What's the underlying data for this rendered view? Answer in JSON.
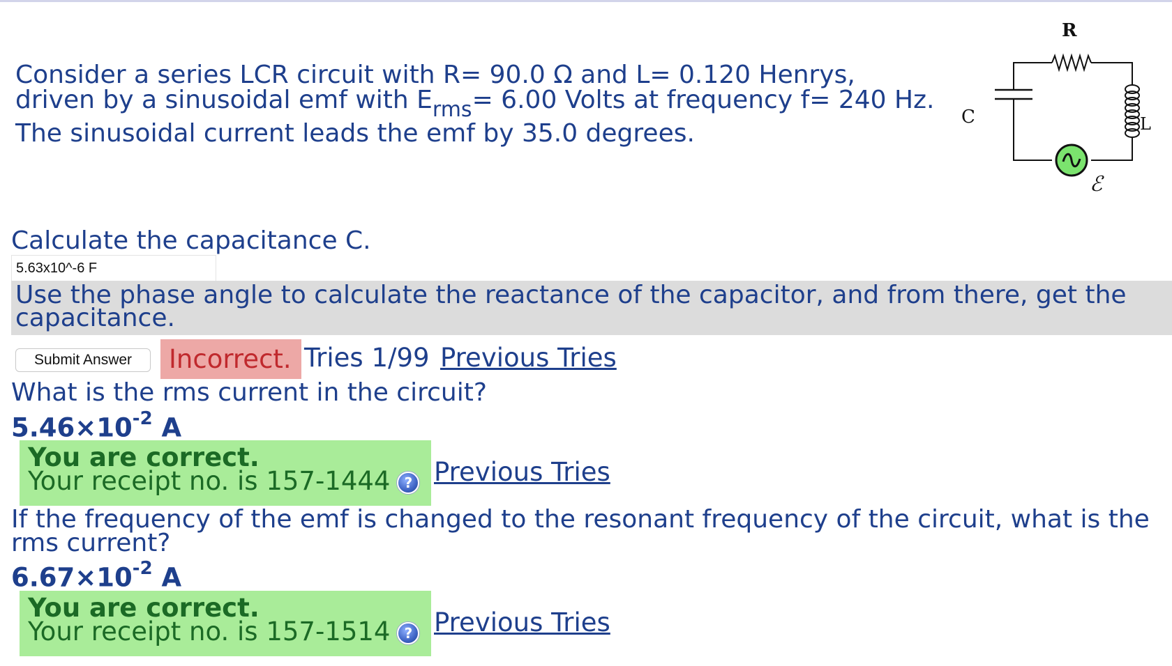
{
  "problem": {
    "line1": "Consider a series LCR circuit with R= 90.0 Ω and L= 0.120 Henrys,",
    "line2_pre": "driven by a sinusoidal emf with E",
    "line2_sub": "rms",
    "line2_post": "= 6.00 Volts at frequency f= 240 Hz.",
    "line3": "The sinusoidal current leads the emf by 35.0 degrees."
  },
  "circuit": {
    "label_R": "R",
    "label_C": "C",
    "label_L": "L",
    "label_emf": "ℰ",
    "source_color": "#7be36e"
  },
  "q1": {
    "question": "Calculate the capacitance C.",
    "input_value": "5.63x10^-6 F",
    "hint": "Use the phase angle to calculate the reactance of the capacitor, and from there, get the capacitance.",
    "submit_label": "Submit Answer",
    "status": "Incorrect.",
    "tries": "Tries 1/99",
    "previous_tries": "Previous Tries"
  },
  "q2": {
    "question": "What is the rms current in the circuit?",
    "answer_mantissa": "5.46×10",
    "answer_exp": "-2",
    "answer_unit": " A",
    "correct_title": "You are correct.",
    "receipt": "Your receipt no. is 157-1444",
    "previous_tries": "Previous Tries"
  },
  "q3": {
    "question_line1": "If the frequency of the emf is changed to the resonant frequency of the circuit, what is the",
    "question_line2": "rms current?",
    "answer_mantissa": "6.67×10",
    "answer_exp": "-2",
    "answer_unit": " A",
    "correct_title": "You are correct.",
    "receipt": "Your receipt no. is 157-1514",
    "previous_tries": "Previous Tries"
  },
  "colors": {
    "text": "#1e3f8c",
    "incorrect_bg": "#eda8a6",
    "incorrect_text": "#c0292d",
    "correct_bg": "#a9ec99",
    "correct_text": "#1b6a25",
    "hint_bg": "#dcdcdc"
  }
}
